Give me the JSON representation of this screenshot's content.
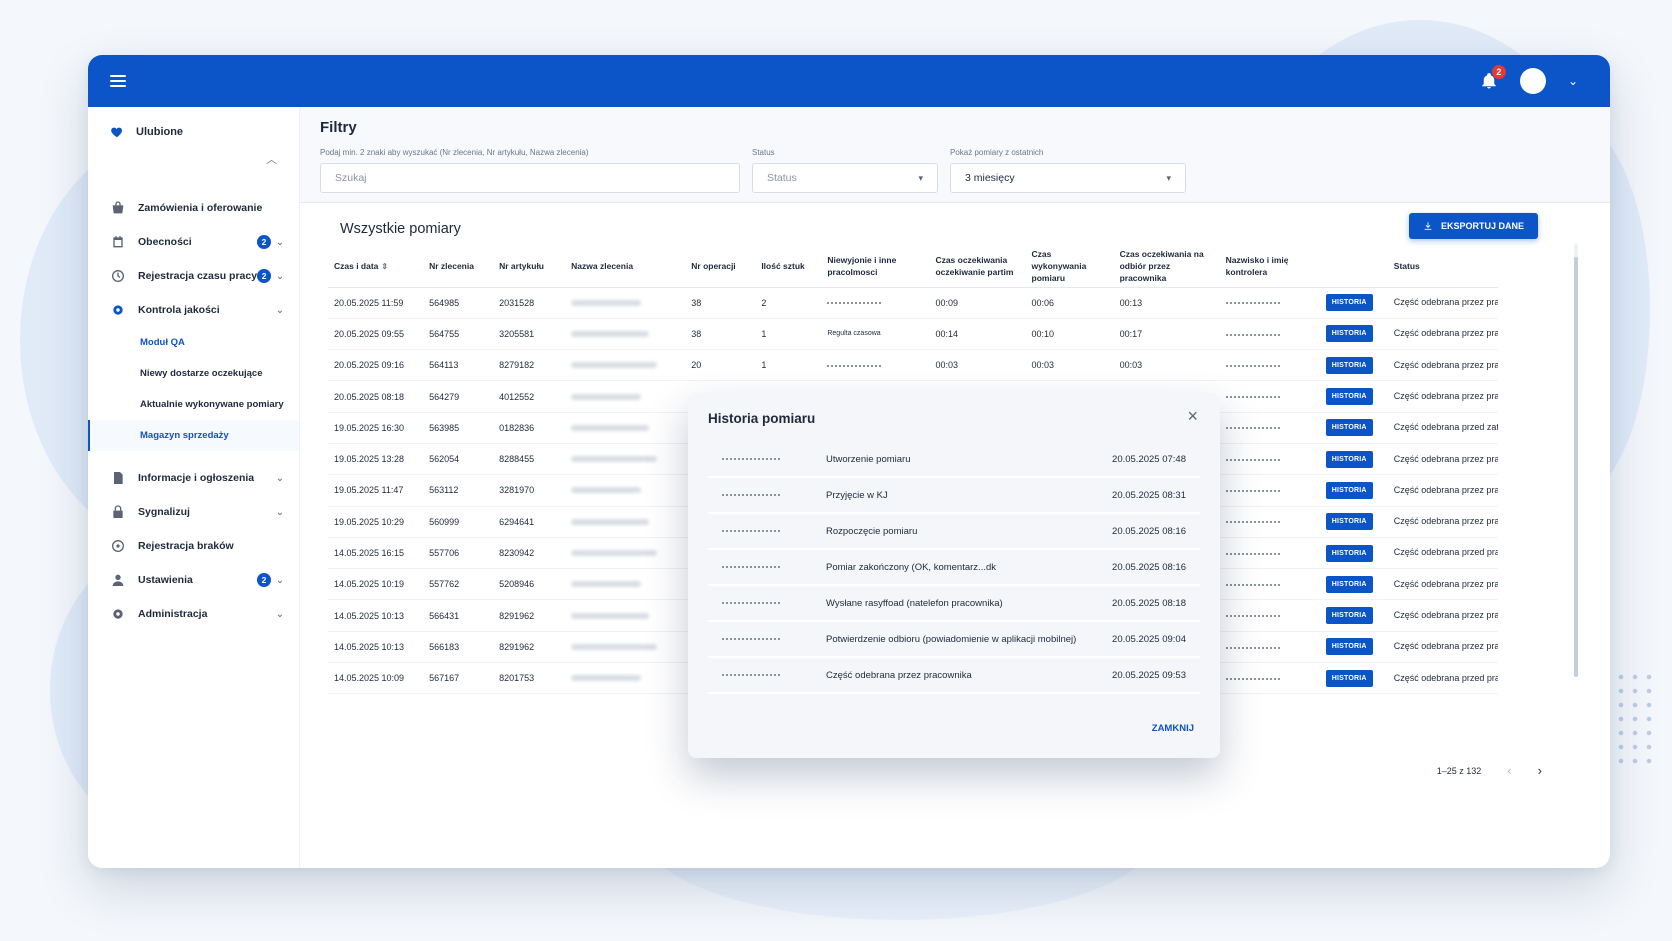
{
  "notifications": {
    "count": "2"
  },
  "sidebar": {
    "favorites": "Ulubione",
    "items": [
      {
        "label": "Zamówienia i oferowanie",
        "badge": ""
      },
      {
        "label": "Obecności",
        "badge": "2"
      },
      {
        "label": "Rejestracja czasu pracy",
        "badge": "2"
      },
      {
        "label": "Kontrola jakości",
        "badge": ""
      }
    ],
    "subitems": [
      {
        "label": "Moduł QA"
      },
      {
        "label": "Niewy dostarze oczekujące"
      },
      {
        "label": "Aktualnie wykonywane pomiary"
      },
      {
        "label": "Magazyn sprzedaży"
      }
    ],
    "items2": [
      {
        "label": "Informacje i ogłoszenia",
        "badge": ""
      },
      {
        "label": "Sygnalizuj",
        "badge": ""
      },
      {
        "label": "Rejestracja braków",
        "badge": ""
      },
      {
        "label": "Ustawienia",
        "badge": "2"
      },
      {
        "label": "Administracja",
        "badge": ""
      }
    ]
  },
  "filters": {
    "title": "Filtry",
    "search_label": "Podaj min. 2 znaki aby wyszukać (Nr zlecenia, Nr artykułu, Nazwa zlecenia)",
    "search_placeholder": "Szukaj",
    "status_label": "Status",
    "status_placeholder": "Status",
    "period_label": "Pokaż pomiary z ostatnich",
    "period_value": "3 miesięcy"
  },
  "list": {
    "title": "Wszystkie pomiary",
    "export_label": "EKSPORTUJ DANE",
    "columns": [
      "Czas i data",
      "Nr zlecenia",
      "Nr artykułu",
      "Nazwa zlecenia",
      "Nr operacji",
      "Ilość sztuk",
      "Niewyjonie i inne pracolmosci",
      "Czas oczekiwania oczekiwanie partim",
      "Czas wykonywania pomiaru",
      "Czas oczekiwania na odbiór przez pracownika",
      "Nazwisko i imię kontrolera",
      "",
      "Status"
    ],
    "history_label": "HISTORIA",
    "rows": [
      {
        "date": "20.05.2025 11:59",
        "order": "564985",
        "article": "2031528",
        "op": "38",
        "qty": "2",
        "note": "",
        "wait": "00:09",
        "exec": "00:06",
        "pickup": "00:13",
        "status": "Część odebrana przez pracownika"
      },
      {
        "date": "20.05.2025 09:55",
        "order": "564755",
        "article": "3205581",
        "op": "38",
        "qty": "1",
        "note": "Regulta czasowa",
        "wait": "00:14",
        "exec": "00:10",
        "pickup": "00:17",
        "status": "Część odebrana przez pracownika"
      },
      {
        "date": "20.05.2025 09:16",
        "order": "564113",
        "article": "8279182",
        "op": "20",
        "qty": "1",
        "note": "",
        "wait": "00:03",
        "exec": "00:03",
        "pickup": "00:03",
        "status": "Część odebrana przez pracownika"
      },
      {
        "date": "20.05.2025 08:18",
        "order": "564279",
        "article": "4012552",
        "op": "",
        "qty": "",
        "note": "",
        "wait": "",
        "exec": "",
        "pickup": "",
        "status": "Część odebrana przez pracownika"
      },
      {
        "date": "19.05.2025 16:30",
        "order": "563985",
        "article": "0182836",
        "op": "",
        "qty": "",
        "note": "",
        "wait": "",
        "exec": "",
        "pickup": "",
        "status": "Część odebrana przed zatwierdzin"
      },
      {
        "date": "19.05.2025 13:28",
        "order": "562054",
        "article": "8288455",
        "op": "",
        "qty": "",
        "note": "",
        "wait": "",
        "exec": "",
        "pickup": "",
        "status": "Część odebrana przez pracownika"
      },
      {
        "date": "19.05.2025 11:47",
        "order": "563112",
        "article": "3281970",
        "op": "",
        "qty": "",
        "note": "",
        "wait": "",
        "exec": "",
        "pickup": "",
        "status": "Część odebrana przez pracownika"
      },
      {
        "date": "19.05.2025 10:29",
        "order": "560999",
        "article": "6294641",
        "op": "",
        "qty": "",
        "note": "",
        "wait": "",
        "exec": "",
        "pickup": "",
        "status": "Część odebrana przez pracownika"
      },
      {
        "date": "14.05.2025 16:15",
        "order": "557706",
        "article": "8230942",
        "op": "",
        "qty": "",
        "note": "",
        "wait": "",
        "exec": "",
        "pickup": "",
        "status": "Część odebrana przed pracownika"
      },
      {
        "date": "14.05.2025 10:19",
        "order": "557762",
        "article": "5208946",
        "op": "",
        "qty": "",
        "note": "",
        "wait": "",
        "exec": "",
        "pickup": "",
        "status": "Część odebrana przez pracownika"
      },
      {
        "date": "14.05.2025 10:13",
        "order": "566431",
        "article": "8291962",
        "op": "",
        "qty": "",
        "note": "",
        "wait": "",
        "exec": "",
        "pickup": "",
        "status": "Część odebrana przez pracownika"
      },
      {
        "date": "14.05.2025 10:13",
        "order": "566183",
        "article": "8291962",
        "op": "",
        "qty": "",
        "note": "",
        "wait": "",
        "exec": "",
        "pickup": "",
        "status": "Część odebrana przez pracownika"
      },
      {
        "date": "14.05.2025 10:09",
        "order": "567167",
        "article": "8201753",
        "op": "",
        "qty": "",
        "note": "",
        "wait": "",
        "exec": "",
        "pickup": "",
        "status": "Część odebrana przed pracownika"
      }
    ],
    "pagination": "1–25 z 132"
  },
  "modal": {
    "title": "Historia pomiaru",
    "close_label": "ZAMKNIJ",
    "events": [
      {
        "event": "Utworzenie pomiaru",
        "date": "20.05.2025 07:48"
      },
      {
        "event": "Przyjęcie w KJ",
        "date": "20.05.2025 08:31"
      },
      {
        "event": "Rozpoczęcie pomiaru",
        "date": "20.05.2025 08:16"
      },
      {
        "event": "Pomiar zakończony (OK, komentarz...dk",
        "date": "20.05.2025 08:16"
      },
      {
        "event": "Wysłane rasyffoad (natelefon pracownika)",
        "date": "20.05.2025 08:18"
      },
      {
        "event": "Potwierdzenie odbioru (powiadomienie w aplikacji mobilnej)",
        "date": "20.05.2025 09:04"
      },
      {
        "event": "Część odebrana przez pracownika",
        "date": "20.05.2025 09:53"
      }
    ]
  },
  "colors": {
    "primary": "#0b55c8",
    "badge_red": "#e53935"
  }
}
